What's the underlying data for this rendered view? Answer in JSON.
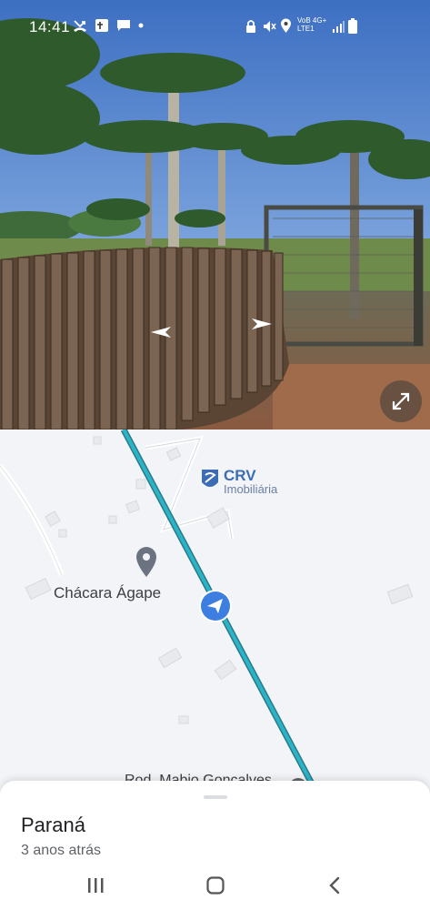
{
  "status_bar": {
    "time": "14:41",
    "network_top": "VoB 4G+",
    "network_bottom": "LTE1"
  },
  "map": {
    "place_label": "Chácara Ágape",
    "road_label": "Rod. Mabio Goncalves",
    "brand_name": "CRV",
    "brand_sub": "Imobiliária",
    "route_color": "#2bb3c8"
  },
  "sheet": {
    "title": "Paraná",
    "subtitle": "3 anos atrás"
  },
  "icons": {
    "status_left": [
      "missed-call-icon",
      "photo-icon",
      "message-icon",
      "dot-icon"
    ],
    "status_right": [
      "lock-icon",
      "mute-icon",
      "location-icon",
      "signal-icon",
      "battery-icon"
    ],
    "nav": [
      "recents-icon",
      "home-icon",
      "back-icon"
    ]
  }
}
